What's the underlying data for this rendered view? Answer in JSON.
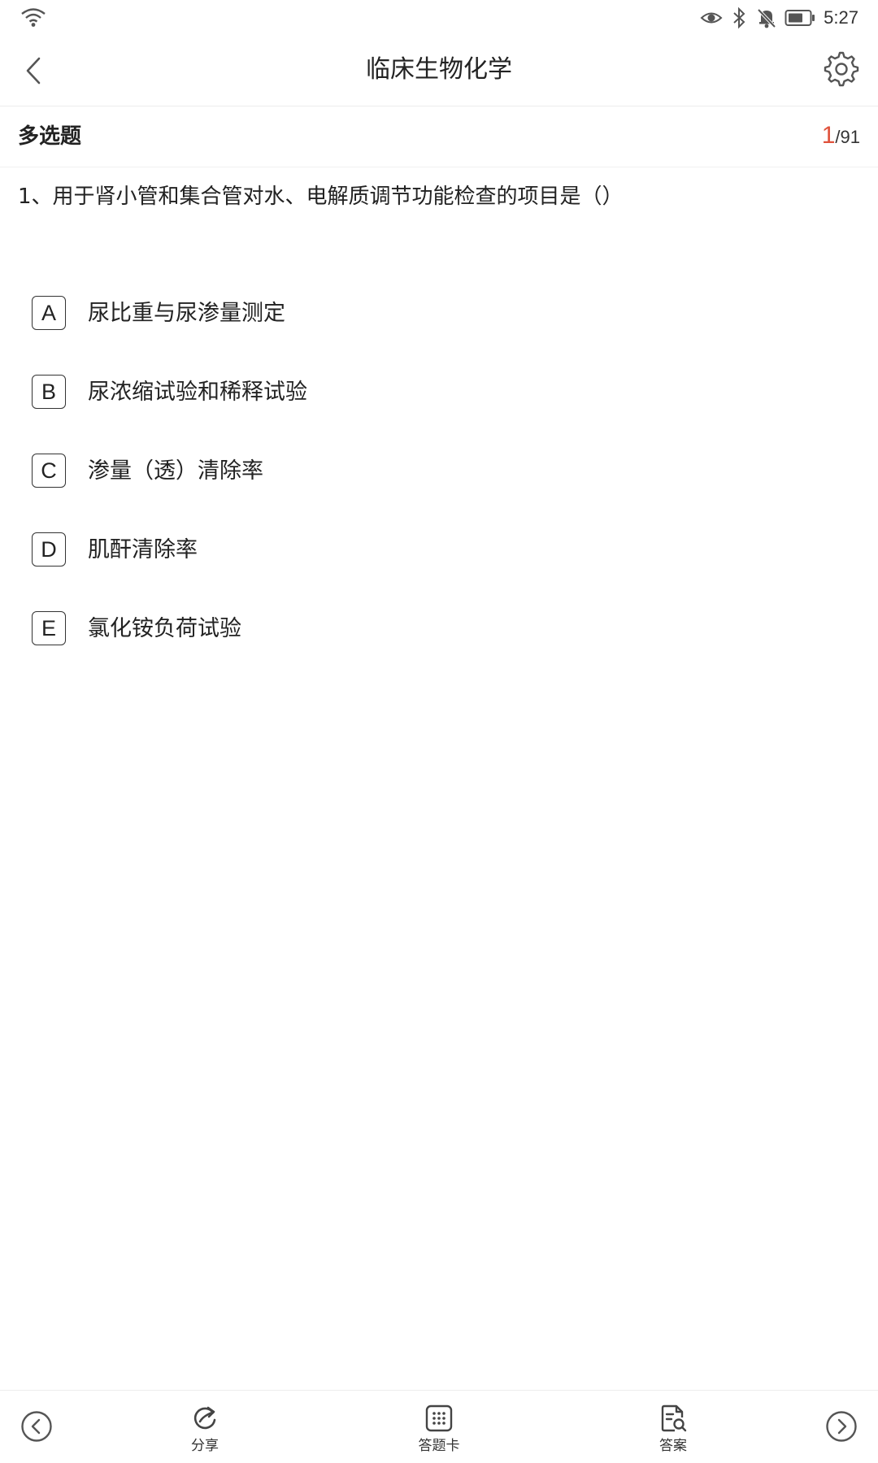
{
  "status_bar": {
    "time": "5:27",
    "icons": [
      "wifi-icon",
      "eye-icon",
      "bluetooth-icon",
      "bell-muted-icon",
      "battery-icon"
    ]
  },
  "nav": {
    "title": "临床生物化学",
    "back_icon": "chevron-left-icon",
    "settings_icon": "gear-icon"
  },
  "question": {
    "type_label": "多选题",
    "current": "1",
    "separator": "/",
    "total": "91",
    "text": "1、用于肾小管和集合管对水、电解质调节功能检查的项目是（）",
    "options": [
      {
        "letter": "A",
        "text": "尿比重与尿渗量测定"
      },
      {
        "letter": "B",
        "text": "尿浓缩试验和稀释试验"
      },
      {
        "letter": "C",
        "text": "渗量（透）清除率"
      },
      {
        "letter": "D",
        "text": "肌酐清除率"
      },
      {
        "letter": "E",
        "text": "氯化铵负荷试验"
      }
    ]
  },
  "toolbar": {
    "share_label": "分享",
    "card_label": "答题卡",
    "answer_label": "答案"
  },
  "colors": {
    "accent": "#e0523c",
    "text": "#222222",
    "divider": "#ececec"
  }
}
